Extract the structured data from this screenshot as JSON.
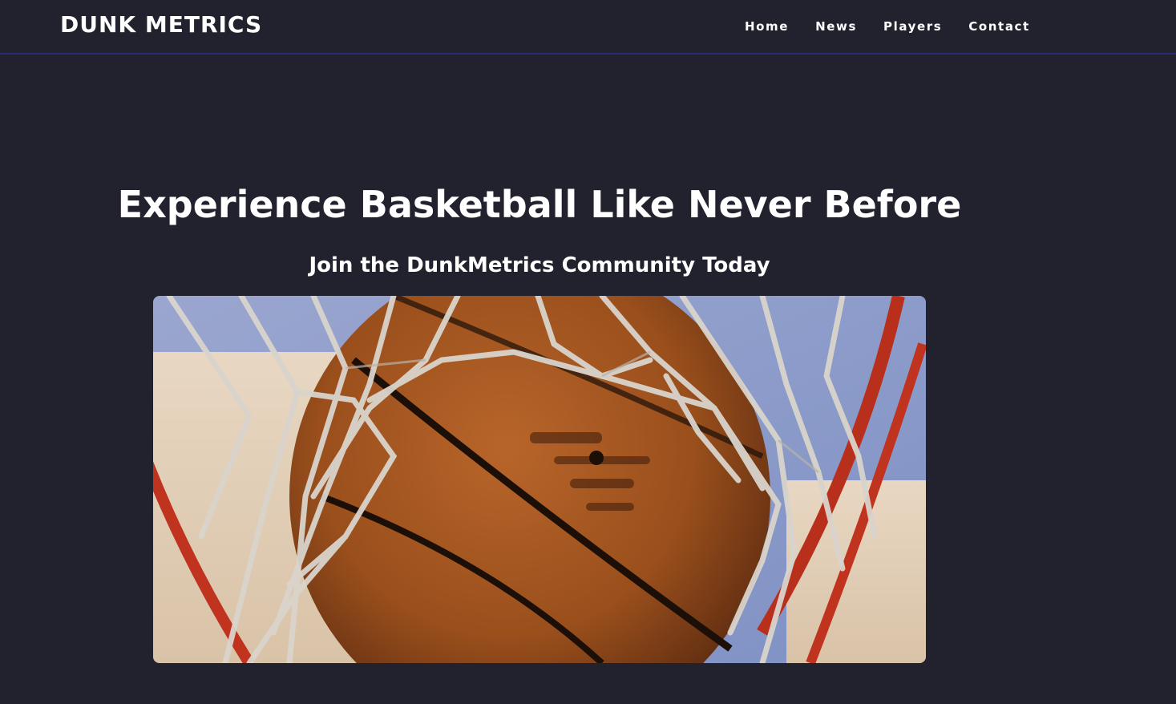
{
  "navbar": {
    "brand": "DUNK METRICS",
    "links": [
      {
        "label": "Home"
      },
      {
        "label": "News"
      },
      {
        "label": "Players"
      },
      {
        "label": "Contact"
      }
    ]
  },
  "hero": {
    "title": "Experience Basketball Like Never Before",
    "subtitle": "Join the DunkMetrics Community Today",
    "image": {
      "subject": "basketball-through-net-photo"
    }
  },
  "colors": {
    "background": "#22222e",
    "navbar_border": "#2a2a72",
    "text": "#ffffff",
    "ball": "#a5561f",
    "sky": "#8f9fc9",
    "rim": "#c0331e",
    "net": "#d9d4cc"
  }
}
